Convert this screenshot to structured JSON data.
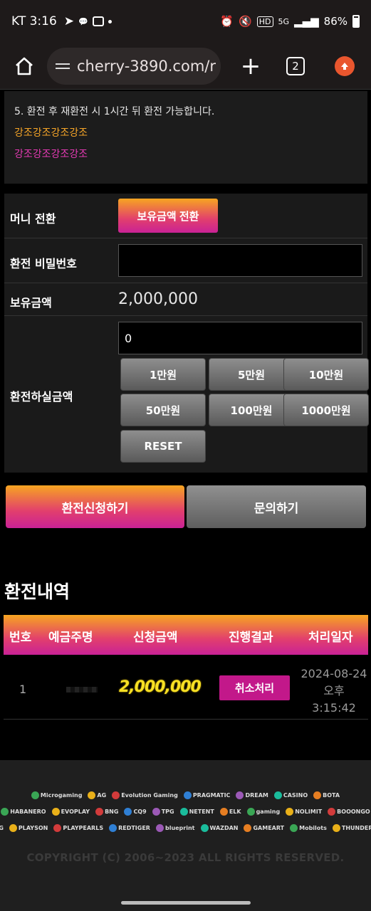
{
  "status_bar": {
    "time": "KT 3:16",
    "battery": "86%",
    "network": "5G"
  },
  "browser": {
    "url": "cherry-3890.com/r",
    "tab_count": "2"
  },
  "notice": {
    "line1": "5. 환전 후 재환전 시 1시간 뒤 환전 가능합니다.",
    "line2": "강조강조강조강조",
    "line3": "강조강조강조강조",
    "colors": {
      "line2": "#f7a628",
      "line3": "#e63ab5"
    }
  },
  "form": {
    "money_convert_label": "머니 전환",
    "convert_button": "보유금액 전환",
    "password_label": "환전 비밀번호",
    "password_value": "",
    "balance_label": "보유금액",
    "balance_value": "2,000,000",
    "amount_label": "환전하실금액",
    "amount_value": "0",
    "chips": [
      "1만원",
      "5만원",
      "10만원",
      "50만원",
      "100만원",
      "1000만원",
      "RESET"
    ]
  },
  "actions": {
    "apply": "환전신청하기",
    "inquiry": "문의하기"
  },
  "history": {
    "title": "환전내역",
    "columns": [
      "번호",
      "예금주명",
      "신청금액",
      "진행결과",
      "처리일자"
    ],
    "rows": [
      {
        "num": "1",
        "name": "",
        "amount": "2,000,000",
        "status": "취소처리",
        "date_line1": "2024-08-24",
        "date_line2": "오후",
        "date_line3": "3:15:42"
      }
    ]
  },
  "footer": {
    "providers_row1": [
      "Microgaming",
      "AG",
      "Evolution Gaming",
      "PRAGMATIC",
      "DREAM",
      "CASINO",
      "BOTA"
    ],
    "providers_row2": [
      "HABANERO",
      "EVOPLAY",
      "BNG",
      "CQ9",
      "TPG",
      "NETENT",
      "ELK",
      "gaming",
      "NOLIMIT",
      "BOOONGO"
    ],
    "providers_row3": [
      "BIG",
      "PLAYSON",
      "PLAYPEARLS",
      "REDTIGER",
      "blueprint",
      "WAZDAN",
      "GAMEART",
      "Mobilots",
      "THUNDERKICK"
    ],
    "copyright": "COPYRIGHT (C) 2006~2023 ALL RIGHTS RESERVED."
  },
  "theme": {
    "accent_orange": "#f7a521",
    "accent_pink": "#c92296",
    "cancel": "#c2188a",
    "amount_gold": "#f7e024"
  }
}
